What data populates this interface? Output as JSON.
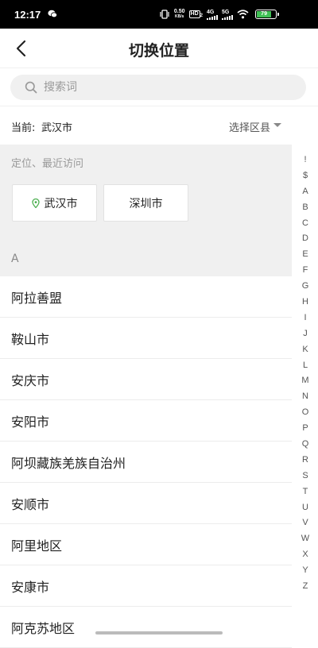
{
  "status_bar": {
    "time": "12:17",
    "speed_line1": "0.50",
    "speed_line2": "KB/s",
    "hd_label": "HD",
    "hd_sub": "2",
    "net1": "4G",
    "net2": "5G",
    "battery": "79"
  },
  "header": {
    "title": "切换位置"
  },
  "search": {
    "placeholder": "搜索词",
    "value": ""
  },
  "current": {
    "label": "当前:",
    "city": "武汉市",
    "district_select": "选择区县"
  },
  "recent": {
    "title": "定位、最近访问",
    "cities": [
      "武汉市",
      "深圳市"
    ]
  },
  "section_letter": "A",
  "city_list": [
    "阿拉善盟",
    "鞍山市",
    "安庆市",
    "安阳市",
    "阿坝藏族羌族自治州",
    "安顺市",
    "阿里地区",
    "安康市",
    "阿克苏地区"
  ],
  "index_letters": [
    "!",
    "$",
    "A",
    "B",
    "C",
    "D",
    "E",
    "F",
    "G",
    "H",
    "I",
    "J",
    "K",
    "L",
    "M",
    "N",
    "O",
    "P",
    "Q",
    "R",
    "S",
    "T",
    "U",
    "V",
    "W",
    "X",
    "Y",
    "Z"
  ],
  "colors": {
    "accent_location": "#4caf50",
    "battery_green": "#40c055"
  }
}
